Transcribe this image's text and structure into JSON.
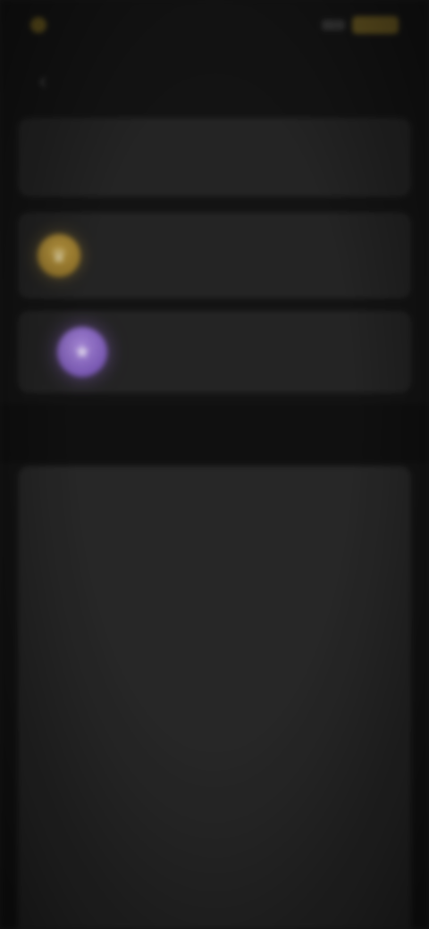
{
  "status_bar": {
    "time": "",
    "signal": "",
    "battery_color": "#6e5c22"
  },
  "header": {
    "title": ""
  },
  "account": {
    "name": "",
    "subtitle": ""
  },
  "membership": {
    "title": "",
    "description": "",
    "badge_color": "#c9a23f"
  },
  "badge": {
    "title": "",
    "description": "",
    "badge_color": "#9a72d8"
  },
  "section": {
    "label": ""
  },
  "settings": {
    "items": [
      {
        "label": ""
      },
      {
        "label": ""
      },
      {
        "label": ""
      },
      {
        "label": ""
      },
      {
        "label": ""
      },
      {
        "label": ""
      },
      {
        "label": ""
      },
      {
        "label": ""
      }
    ]
  },
  "theme": {
    "background": "#141414",
    "card": "#262626",
    "panel": "#2a2a2a"
  }
}
